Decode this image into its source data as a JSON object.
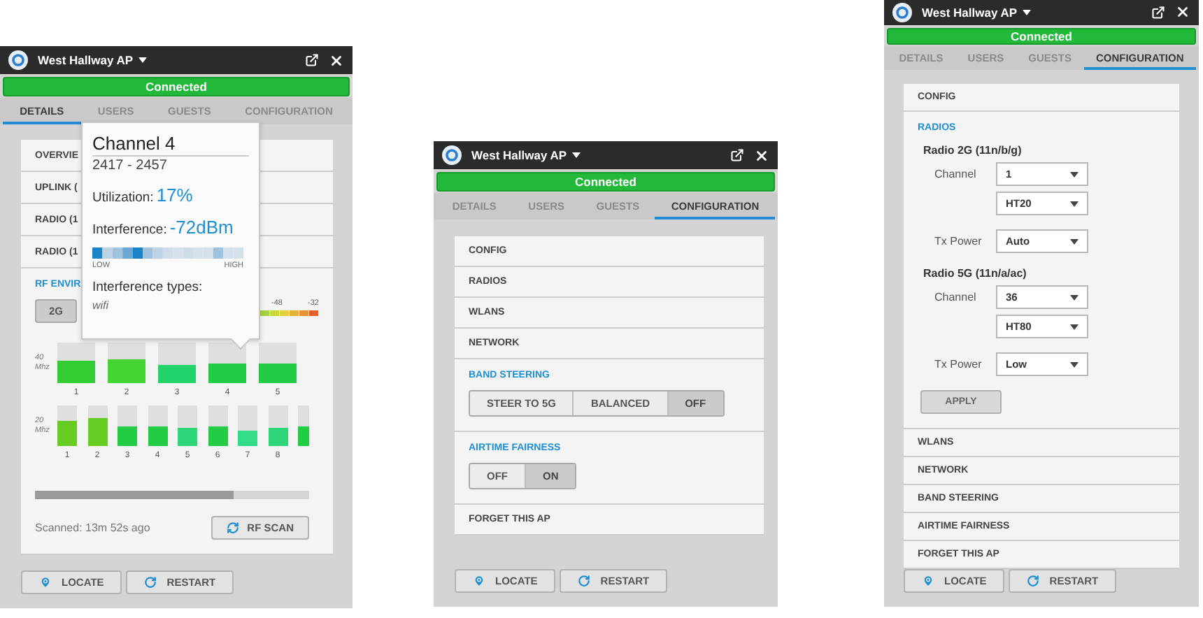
{
  "panels": [
    {
      "title": "West Hallway AP",
      "status": "Connected",
      "tabs": [
        {
          "label": "DETAILS",
          "selected": true
        },
        {
          "label": "USERS",
          "selected": false
        },
        {
          "label": "GUESTS",
          "selected": false
        },
        {
          "label": "CONFIGURATION",
          "selected": false
        }
      ],
      "sections": [
        {
          "kind": "row",
          "label": "OVERVIE"
        },
        {
          "kind": "row",
          "label": "UPLINK ("
        },
        {
          "kind": "row",
          "label": "RADIO (1"
        },
        {
          "kind": "row",
          "label": "RADIO (1"
        },
        {
          "kind": "rf",
          "label": "RF ENVIR",
          "bands": [
            {
              "label": "2G",
              "selected": true
            }
          ],
          "scale": [
            "-48",
            "-32"
          ],
          "groups": [
            {
              "label": "40 Mhz",
              "channels": [
                {
                  "label": "1",
                  "level": 0.55,
                  "color": "#33cc33"
                },
                {
                  "label": "2",
                  "level": 0.6,
                  "color": "#44d433"
                },
                {
                  "label": "3",
                  "level": 0.45,
                  "color": "#22d46a"
                },
                {
                  "label": "4",
                  "level": 0.5,
                  "color": "#22cc44"
                },
                {
                  "label": "5",
                  "level": 0.5,
                  "color": "#22cc44"
                }
              ]
            },
            {
              "label": "20 Mhz",
              "channels": [
                {
                  "label": "1",
                  "level": 0.62,
                  "color": "#66cc22"
                },
                {
                  "label": "2",
                  "level": 0.68,
                  "color": "#66cc22"
                },
                {
                  "label": "3",
                  "level": 0.5,
                  "color": "#22cc44"
                },
                {
                  "label": "4",
                  "level": 0.5,
                  "color": "#22cc44"
                },
                {
                  "label": "5",
                  "level": 0.45,
                  "color": "#2ed67a"
                },
                {
                  "label": "6",
                  "level": 0.5,
                  "color": "#22cc44"
                },
                {
                  "label": "7",
                  "level": 0.38,
                  "color": "#33dd88"
                },
                {
                  "label": "8",
                  "level": 0.45,
                  "color": "#2ed67a"
                },
                {
                  "level": 0.5,
                  "color": "#22cc44"
                }
              ]
            }
          ],
          "scanned": "Scanned: 13m 52s ago",
          "scan_button": "RF SCAN"
        }
      ],
      "tooltip": {
        "title": "Channel 4",
        "range": "2417 - 2457",
        "utilization_label": "Utilization:",
        "utilization": "17%",
        "interference_label": "Interference:",
        "interference": "-72dBm",
        "low": "LOW",
        "high": "HIGH",
        "types_label": "Interference types:",
        "types": "wifi"
      },
      "actions": [
        "LOCATE",
        "RESTART"
      ]
    },
    {
      "title": "West Hallway AP",
      "status": "Connected",
      "tabs": [
        {
          "label": "DETAILS",
          "selected": false
        },
        {
          "label": "USERS",
          "selected": false
        },
        {
          "label": "GUESTS",
          "selected": false
        },
        {
          "label": "CONFIGURATION",
          "selected": true
        }
      ],
      "sections": [
        {
          "kind": "row",
          "label": "CONFIG"
        },
        {
          "kind": "row",
          "label": "RADIOS"
        },
        {
          "kind": "row",
          "label": "WLANS"
        },
        {
          "kind": "row",
          "label": "NETWORK"
        },
        {
          "kind": "segmented",
          "label": "BAND STEERING",
          "options": [
            {
              "label": "STEER TO 5G",
              "selected": false
            },
            {
              "label": "BALANCED",
              "selected": false
            },
            {
              "label": "OFF",
              "selected": true
            }
          ]
        },
        {
          "kind": "segmented",
          "label": "AIRTIME FAIRNESS",
          "options": [
            {
              "label": "OFF",
              "selected": false
            },
            {
              "label": "ON",
              "selected": true
            }
          ]
        },
        {
          "kind": "row",
          "label": "FORGET THIS AP"
        }
      ],
      "actions": [
        "LOCATE",
        "RESTART"
      ]
    },
    {
      "title": "West Hallway AP",
      "status": "Connected",
      "tabs": [
        {
          "label": "DETAILS",
          "selected": false
        },
        {
          "label": "USERS",
          "selected": false
        },
        {
          "label": "GUESTS",
          "selected": false
        },
        {
          "label": "CONFIGURATION",
          "selected": true
        }
      ],
      "sections": [
        {
          "kind": "row",
          "label": "CONFIG"
        },
        {
          "kind": "radios",
          "label": "RADIOS",
          "radios": [
            {
              "name": "Radio 2G (11n/b/g)",
              "fields": [
                {
                  "label": "Channel",
                  "value": "1"
                },
                {
                  "value": "HT20"
                },
                {
                  "label": "Tx Power",
                  "value": "Auto"
                }
              ]
            },
            {
              "name": "Radio 5G (11n/a/ac)",
              "fields": [
                {
                  "label": "Channel",
                  "value": "36"
                },
                {
                  "value": "HT80"
                },
                {
                  "label": "Tx Power",
                  "value": "Low"
                }
              ]
            }
          ],
          "apply": "APPLY"
        },
        {
          "kind": "row",
          "label": "WLANS"
        },
        {
          "kind": "row",
          "label": "NETWORK"
        },
        {
          "kind": "row",
          "label": "BAND STEERING"
        },
        {
          "kind": "row",
          "label": "AIRTIME FAIRNESS"
        },
        {
          "kind": "row",
          "label": "FORGET THIS AP"
        }
      ],
      "actions": [
        "LOCATE",
        "RESTART"
      ]
    }
  ]
}
